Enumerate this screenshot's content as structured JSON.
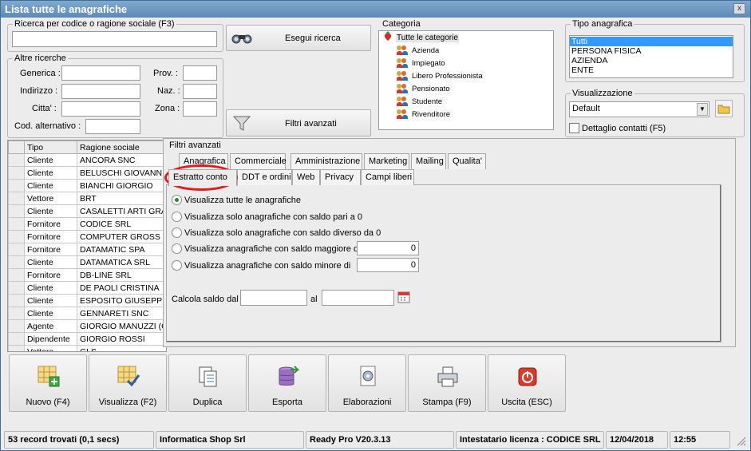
{
  "window": {
    "title": "Lista tutte le anagrafiche",
    "close_label": "x"
  },
  "search": {
    "group_title": "Ricerca per codice o ragione sociale (F3)",
    "value": "",
    "button_label": "Esegui ricerca"
  },
  "altre": {
    "group_title": "Altre ricerche",
    "generica": "Generica :",
    "indirizzo": "Indirizzo :",
    "citta": "Citta' :",
    "cod_alt": "Cod. alternativo :",
    "prov": "Prov. :",
    "naz": "Naz. :",
    "zona": "Zona :"
  },
  "filtri_button": "Filtri avanzati",
  "categoria": {
    "title": "Categoria",
    "root": "Tutte le categorie",
    "items": [
      "Azienda",
      "Impiegato",
      "Libero Professionista",
      "Pensionato",
      "Studente",
      "Rivenditore"
    ]
  },
  "tipo": {
    "title": "Tipo anagrafica",
    "items": [
      "Tutti",
      "PERSONA FISICA",
      "AZIENDA",
      "ENTE"
    ],
    "selected": "Tutti"
  },
  "visualizzazione": {
    "title": "Visualizzazione",
    "value": "Default",
    "dettaglio": "Dettaglio contatti (F5)"
  },
  "grid": {
    "headers": [
      "Tipo",
      "Ragione sociale"
    ],
    "rows": [
      [
        "Cliente",
        "ANCORA SNC"
      ],
      [
        "Cliente",
        "BELUSCHI GIOVANNI"
      ],
      [
        "Cliente",
        "BIANCHI GIORGIO"
      ],
      [
        "Vettore",
        "BRT"
      ],
      [
        "Cliente",
        "CASALETTI ARTI GRA"
      ],
      [
        "Fornitore",
        "CODICE SRL"
      ],
      [
        "Fornitore",
        "COMPUTER GROSS SR"
      ],
      [
        "Fornitore",
        "DATAMATIC SPA"
      ],
      [
        "Cliente",
        "DATAMATICA SRL"
      ],
      [
        "Fornitore",
        "DB-LINE SRL"
      ],
      [
        "Cliente",
        "DE PAOLI CRISTINA"
      ],
      [
        "Cliente",
        "ESPOSITO GIUSEPPE"
      ],
      [
        "Cliente",
        "GENNARETI SNC"
      ],
      [
        "Agente",
        "GIORGIO MANUZZI (C"
      ],
      [
        "Dipendente",
        "GIORGIO ROSSI"
      ],
      [
        "Vettore",
        "GLS"
      ]
    ]
  },
  "filtri": {
    "title": "Filtri avanzati",
    "tabs_row1": [
      "Anagrafica",
      "Commerciale",
      "Amministrazione",
      "Marketing",
      "Mailing",
      "Qualita'"
    ],
    "tabs_row2": [
      "Estratto conto",
      "DDT e ordini",
      "Web",
      "Privacy",
      "Campi liberi"
    ],
    "active_tab": "Estratto conto",
    "options": [
      "Visualizza tutte le anagrafiche",
      "Visualizza solo anagrafiche con saldo pari a 0",
      "Visualizza solo anagrafiche con saldo diverso da 0",
      "Visualizza anagrafiche con saldo maggiore di",
      "Visualizza anagrafiche con saldo minore di"
    ],
    "maggiore_value": "0",
    "minore_value": "0",
    "calcola_label": "Calcola saldo dal",
    "al_label": "al",
    "dal_value": "",
    "al_value": ""
  },
  "toolbar": [
    "Nuovo (F4)",
    "Visualizza (F2)",
    "Duplica",
    "Esporta",
    "Elaborazioni",
    "Stampa (F9)",
    "Uscita (ESC)"
  ],
  "statusbar": {
    "records": "53 record trovati (0,1 secs)",
    "company": "Informatica Shop Srl",
    "version": "Ready Pro V20.3.13",
    "license": "Intestatario licenza : CODICE SRL",
    "date": "12/04/2018",
    "time": "12:55"
  },
  "colors": {
    "accent": "#3399ff",
    "title_bar": "#5d8ab5",
    "highlight": "#e21b1b"
  }
}
